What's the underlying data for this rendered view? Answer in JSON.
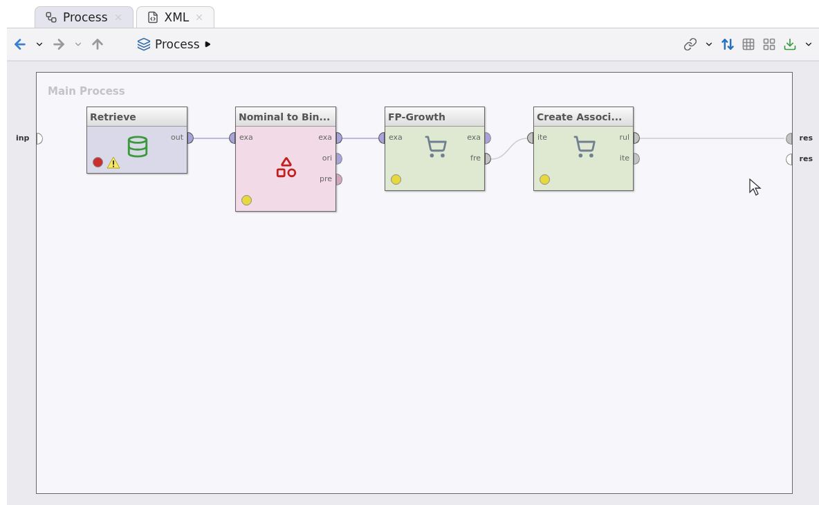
{
  "tabs": [
    {
      "label": "Process",
      "kind": "process",
      "selected": true
    },
    {
      "label": "XML",
      "kind": "xml",
      "selected": false
    }
  ],
  "toolbar": {
    "breadcrumb": "Process"
  },
  "process": {
    "title": "Main Process",
    "inputs": [
      {
        "label": "inp",
        "connected": false
      }
    ],
    "outputs": [
      {
        "label": "res",
        "connected": true
      },
      {
        "label": "res",
        "connected": false
      }
    ],
    "operators": [
      {
        "title": "Retrieve",
        "kind": "database",
        "color": "#d9d9ea",
        "status_light": {
          "color": "#c83030"
        },
        "warning": true,
        "outputs": [
          {
            "label": "out",
            "color": "#a9a3dc",
            "connected": true
          }
        ]
      },
      {
        "title": "Nominal to Bin...",
        "kind": "conversion",
        "color": "#f2dbe6",
        "status_light": {
          "color": "#e8d840"
        },
        "warning": false,
        "inputs": [
          {
            "label": "exa",
            "color": "#a9a3dc"
          }
        ],
        "outputs": [
          {
            "label": "exa",
            "color": "#a9a3dc",
            "connected": true
          },
          {
            "label": "ori",
            "color": "#a9a3dc",
            "connected": false
          },
          {
            "label": "pre",
            "color": "#d6a6c0",
            "connected": false
          }
        ]
      },
      {
        "title": "FP-Growth",
        "kind": "cart",
        "color": "#dfe9d2",
        "status_light": {
          "color": "#e8d840"
        },
        "warning": false,
        "inputs": [
          {
            "label": "exa",
            "color": "#a9a3dc"
          }
        ],
        "outputs": [
          {
            "label": "exa",
            "color": "#a9a3dc",
            "connected": false
          },
          {
            "label": "fre",
            "color": "#c4c4c4",
            "connected": true
          }
        ]
      },
      {
        "title": "Create Associ...",
        "kind": "cart",
        "color": "#dfe9d2",
        "status_light": {
          "color": "#e8d840"
        },
        "warning": false,
        "inputs": [
          {
            "label": "ite",
            "color": "#c4c4c4"
          }
        ],
        "outputs": [
          {
            "label": "rul",
            "color": "#c4c4c4",
            "connected": true
          },
          {
            "label": "ite",
            "color": "#c4c4c4",
            "connected": false
          }
        ]
      }
    ]
  }
}
